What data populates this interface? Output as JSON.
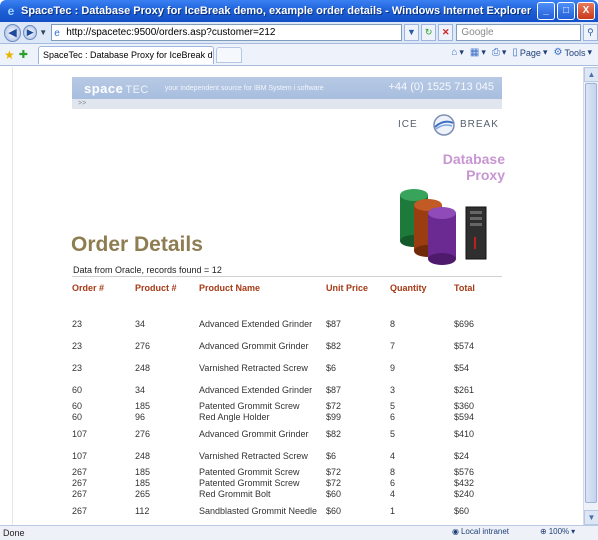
{
  "window": {
    "title": "SpaceTec : Database Proxy for IceBreak demo, example order details - Windows Internet Explorer",
    "controls": [
      "_",
      "□",
      "X"
    ]
  },
  "address": {
    "url": "http://spacetec:9500/orders.asp?customer=212",
    "search_placeholder": "Google"
  },
  "tabs": {
    "active_tab": "SpaceTec : Database Proxy for IceBreak demo, exam...",
    "commands": [
      {
        "icon": "home-icon",
        "label": ""
      },
      {
        "icon": "feeds-icon",
        "label": ""
      },
      {
        "icon": "print-icon",
        "label": ""
      },
      {
        "icon": "page-icon",
        "label": "Page"
      },
      {
        "icon": "tools-icon",
        "label": "Tools"
      }
    ]
  },
  "banner": {
    "brand": "space",
    "brand_suffix": "TEC",
    "tagline": "your independent source for IBM System i software",
    "phone": "+44 (0) 1525 713 045",
    "crumb": ">>"
  },
  "logo": {
    "left": "ICE",
    "right": "BREAK"
  },
  "db_graphic": {
    "line1": "Database",
    "line2": "Proxy",
    "colors": [
      "#1e7a3a",
      "#9a3d10",
      "#6b2a92",
      "#2f2f2f"
    ]
  },
  "page": {
    "heading": "Order Details",
    "subline": "Data from Oracle, records found = 12"
  },
  "table": {
    "headers": [
      "Order #",
      "Product #",
      "Product Name",
      "Unit Price",
      "Quantity",
      "Total"
    ],
    "rows": [
      {
        "order": "23",
        "product": "34",
        "name": "Advanced Extended Grinder",
        "price": "$87",
        "qty": "8",
        "total": "$696",
        "tall": true
      },
      {
        "order": "23",
        "product": "276",
        "name": "Advanced Grommit Grinder",
        "price": "$82",
        "qty": "7",
        "total": "$574",
        "tall": true
      },
      {
        "order": "23",
        "product": "248",
        "name": "Varnished Retracted Screw",
        "price": "$6",
        "qty": "9",
        "total": "$54",
        "tall": true
      },
      {
        "order": "60",
        "product": "34",
        "name": "Advanced Extended Grinder",
        "price": "$87",
        "qty": "3",
        "total": "$261",
        "tall": true
      },
      {
        "order": "60",
        "product": "185",
        "name": "Patented Grommit Screw",
        "price": "$72",
        "qty": "5",
        "total": "$360",
        "tall": false
      },
      {
        "order": "60",
        "product": "96",
        "name": "Red Angle Holder",
        "price": "$99",
        "qty": "6",
        "total": "$594",
        "tall": false
      },
      {
        "order": "107",
        "product": "276",
        "name": "Advanced Grommit Grinder",
        "price": "$82",
        "qty": "5",
        "total": "$410",
        "tall": true
      },
      {
        "order": "107",
        "product": "248",
        "name": "Varnished Retracted Screw",
        "price": "$6",
        "qty": "4",
        "total": "$24",
        "tall": true
      },
      {
        "order": "267",
        "product": "185",
        "name": "Patented Grommit Screw",
        "price": "$72",
        "qty": "8",
        "total": "$576",
        "tall": false
      },
      {
        "order": "267",
        "product": "185",
        "name": "Patented Grommit Screw",
        "price": "$72",
        "qty": "6",
        "total": "$432",
        "tall": false
      },
      {
        "order": "267",
        "product": "265",
        "name": "Red Grommit Bolt",
        "price": "$60",
        "qty": "4",
        "total": "$240",
        "tall": false
      },
      {
        "order": "267",
        "product": "112",
        "name": "Sandblasted Grommit Needle",
        "price": "$60",
        "qty": "1",
        "total": "$60",
        "tall": true
      }
    ]
  },
  "status": {
    "text": "Done",
    "zone": "Local intranet",
    "zoom": "100%"
  }
}
